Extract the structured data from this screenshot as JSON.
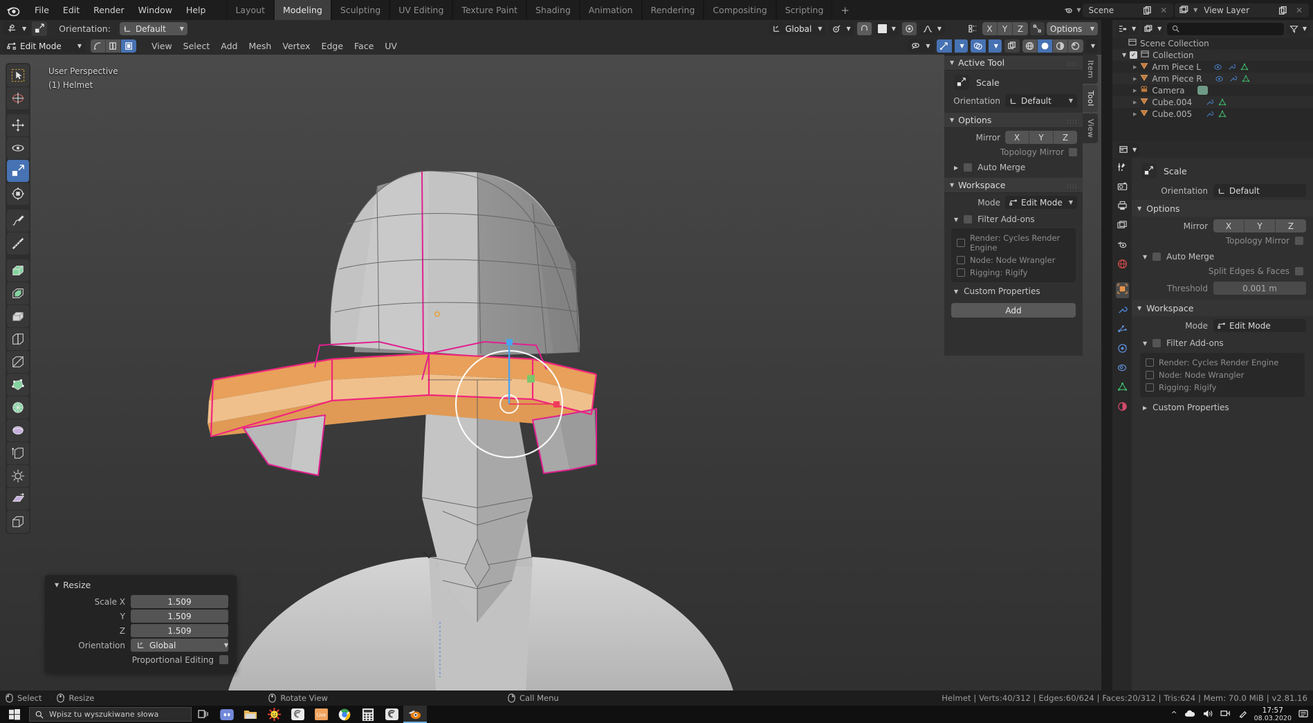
{
  "app": {
    "name": "Blender",
    "version_label": "v2.81.16"
  },
  "topbar": {
    "menus": [
      "File",
      "Edit",
      "Render",
      "Window",
      "Help"
    ],
    "workspace_tabs": [
      {
        "label": "Layout",
        "active": false
      },
      {
        "label": "Modeling",
        "active": true
      },
      {
        "label": "Sculpting",
        "active": false
      },
      {
        "label": "UV Editing",
        "active": false
      },
      {
        "label": "Texture Paint",
        "active": false
      },
      {
        "label": "Shading",
        "active": false
      },
      {
        "label": "Animation",
        "active": false
      },
      {
        "label": "Rendering",
        "active": false
      },
      {
        "label": "Compositing",
        "active": false
      },
      {
        "label": "Scripting",
        "active": false
      }
    ],
    "add_workspace": "+",
    "scene_name": "Scene",
    "view_layer_name": "View Layer"
  },
  "viewport_header": {
    "orientation_label": "Orientation:",
    "orientation_value": "Default",
    "transform_orientation": "Global",
    "options_label": "Options",
    "mirror_axes": [
      "X",
      "Y",
      "Z"
    ],
    "mode": "Edit Mode",
    "menus": [
      "View",
      "Select",
      "Add",
      "Mesh",
      "Vertex",
      "Edge",
      "Face",
      "UV"
    ]
  },
  "viewport": {
    "perspective_text": "User Perspective",
    "object_text": "(1) Helmet",
    "gizmo_axes": [
      "X",
      "Y",
      "Z"
    ],
    "tools": [
      {
        "name": "tweak-tool",
        "active": false
      },
      {
        "name": "cursor-tool",
        "active": false
      },
      {
        "name": "move-tool",
        "active": false
      },
      {
        "name": "rotate-tool",
        "active": false
      },
      {
        "name": "scale-tool",
        "active": true
      },
      {
        "name": "transform-tool",
        "active": false
      },
      {
        "name": "annotate-tool",
        "active": false
      },
      {
        "name": "measure-tool",
        "active": false
      },
      {
        "name": "extrude-region-tool",
        "active": false
      },
      {
        "name": "inset-faces-tool",
        "active": false
      },
      {
        "name": "bevel-tool",
        "active": false
      },
      {
        "name": "loop-cut-tool",
        "active": false
      },
      {
        "name": "knife-tool",
        "active": false
      },
      {
        "name": "poly-build-tool",
        "active": false
      },
      {
        "name": "spin-tool",
        "active": false
      },
      {
        "name": "smooth-tool",
        "active": false
      },
      {
        "name": "edge-slide-tool",
        "active": false
      },
      {
        "name": "shrink-fatten-tool",
        "active": false
      },
      {
        "name": "shear-tool",
        "active": false
      },
      {
        "name": "rip-region-tool",
        "active": false
      }
    ]
  },
  "operator_panel": {
    "title": "Resize",
    "fields": [
      {
        "label": "Scale X",
        "value": "1.509"
      },
      {
        "label": "Y",
        "value": "1.509"
      },
      {
        "label": "Z",
        "value": "1.509"
      }
    ],
    "orientation_label": "Orientation",
    "orientation_value": "Global",
    "proportional_label": "Proportional Editing",
    "proportional_checked": false
  },
  "npanel": {
    "tabs": [
      {
        "label": "Item",
        "active": false
      },
      {
        "label": "Tool",
        "active": true
      },
      {
        "label": "View",
        "active": false
      }
    ],
    "active_tool": {
      "header": "Active Tool",
      "tool_name": "Scale",
      "orientation_label": "Orientation",
      "orientation_value": "Default"
    },
    "options": {
      "header": "Options",
      "mirror_label": "Mirror",
      "mirror_axes": [
        "X",
        "Y",
        "Z"
      ],
      "topology_mirror_label": "Topology Mirror",
      "auto_merge_label": "Auto Merge"
    },
    "workspace": {
      "header": "Workspace",
      "mode_label": "Mode",
      "mode_value": "Edit Mode",
      "filter_addons_label": "Filter Add-ons",
      "addons": [
        "Render: Cycles Render Engine",
        "Node: Node Wrangler",
        "Rigging: Rigify"
      ],
      "custom_properties_label": "Custom Properties",
      "add_button": "Add"
    }
  },
  "outliner": {
    "search_placeholder": "",
    "rows": [
      {
        "label": "Scene Collection",
        "indent": 0,
        "icon": "collection-icon"
      },
      {
        "label": "Collection",
        "indent": 1,
        "icon": "collection-icon"
      },
      {
        "label": "Arm Piece L",
        "indent": 2,
        "icon": "mesh-data-icon"
      },
      {
        "label": "Arm Piece R",
        "indent": 2,
        "icon": "mesh-data-icon"
      },
      {
        "label": "Camera",
        "indent": 2,
        "icon": "camera-icon"
      },
      {
        "label": "Cube.004",
        "indent": 2,
        "icon": "mesh-data-icon"
      },
      {
        "label": "Cube.005",
        "indent": 2,
        "icon": "mesh-data-icon"
      }
    ]
  },
  "properties": {
    "tool_name": "Scale",
    "orientation_label": "Orientation",
    "orientation_value": "Default",
    "options_header": "Options",
    "mirror_label": "Mirror",
    "mirror_axes": [
      "X",
      "Y",
      "Z"
    ],
    "topology_mirror_label": "Topology Mirror",
    "auto_merge_label": "Auto Merge",
    "split_edges_label": "Split Edges & Faces",
    "threshold_label": "Threshold",
    "threshold_value": "0.001 m",
    "workspace_header": "Workspace",
    "mode_label": "Mode",
    "mode_value": "Edit Mode",
    "filter_addons_label": "Filter Add-ons",
    "addons": [
      "Render: Cycles Render Engine",
      "Node: Node Wrangler",
      "Rigging: Rigify"
    ],
    "custom_properties_label": "Custom Properties",
    "tabs": [
      {
        "name": "tool-tab",
        "color": "#d8d8d8"
      },
      {
        "name": "render-tab",
        "color": "#d0d0d0"
      },
      {
        "name": "output-tab",
        "color": "#d0d0d0"
      },
      {
        "name": "view-layer-tab",
        "color": "#d0d0d0"
      },
      {
        "name": "scene-tab",
        "color": "#d0d0d0"
      },
      {
        "name": "world-tab",
        "color": "#d14a4a"
      },
      {
        "name": "object-tab",
        "color": "#e8954a"
      },
      {
        "name": "modifier-tab",
        "color": "#4a7fd1"
      },
      {
        "name": "particles-tab",
        "color": "#5e8ed8"
      },
      {
        "name": "physics-tab",
        "color": "#5e8ed8"
      },
      {
        "name": "constraints-tab",
        "color": "#5e8ed8"
      },
      {
        "name": "object-data-tab",
        "color": "#3fb86b"
      },
      {
        "name": "material-tab",
        "color": "#d14a6b"
      }
    ]
  },
  "statusbar": {
    "keymap": [
      {
        "icon": "mouse-left-icon",
        "label": "Select"
      },
      {
        "icon": "mouse-wheel-icon",
        "label": "Resize"
      },
      {
        "icon": "mouse-middle-icon",
        "label": "Rotate View"
      },
      {
        "icon": "mouse-right-icon",
        "label": "Call Menu"
      }
    ],
    "stats": "Helmet | Verts:40/312 | Edges:60/624 | Faces:20/312 | Tris:624 | Mem: 70.0 MiB | v2.81.16"
  },
  "taskbar": {
    "search_placeholder": "Wpisz tu wyszukiwane słowa",
    "apps": [
      {
        "name": "task-view-icon"
      },
      {
        "name": "discord-icon"
      },
      {
        "name": "file-explorer-icon"
      },
      {
        "name": "sun-app-icon"
      },
      {
        "name": "gimp-icon"
      },
      {
        "name": "live-app-icon"
      },
      {
        "name": "chrome-icon"
      },
      {
        "name": "calculator-icon"
      },
      {
        "name": "sketch-app-icon"
      },
      {
        "name": "blender-icon"
      }
    ],
    "time": "17:57",
    "date": "08.03.2020"
  }
}
